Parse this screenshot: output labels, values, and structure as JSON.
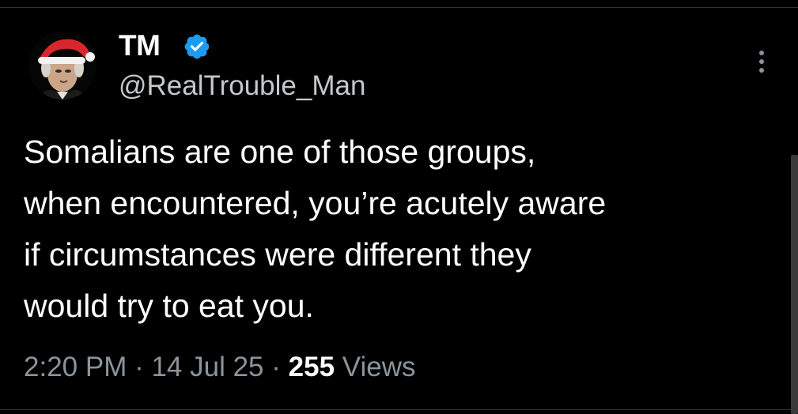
{
  "colors": {
    "background": "#000000",
    "primary_text": "#ffffff",
    "secondary_text": "#8b949b",
    "verified_badge": "#1d9bf0",
    "divider": "#2f3336"
  },
  "author": {
    "display_name": "TM",
    "handle": "@RealTrouble_Man",
    "verified": true,
    "avatar_icon": "avatar-santa-hat-portrait"
  },
  "menu": {
    "icon": "more-vertical-icon"
  },
  "tweet": {
    "lines": [
      "Somalians are one of those groups,",
      "when encountered, you’re acutely aware",
      "if circumstances were different they",
      "would try to eat you."
    ]
  },
  "meta": {
    "time": "2:20 PM",
    "separator_1": " · ",
    "date": "14 Jul 25",
    "separator_2": " · ",
    "views_count": "255",
    "views_label": " Views"
  }
}
